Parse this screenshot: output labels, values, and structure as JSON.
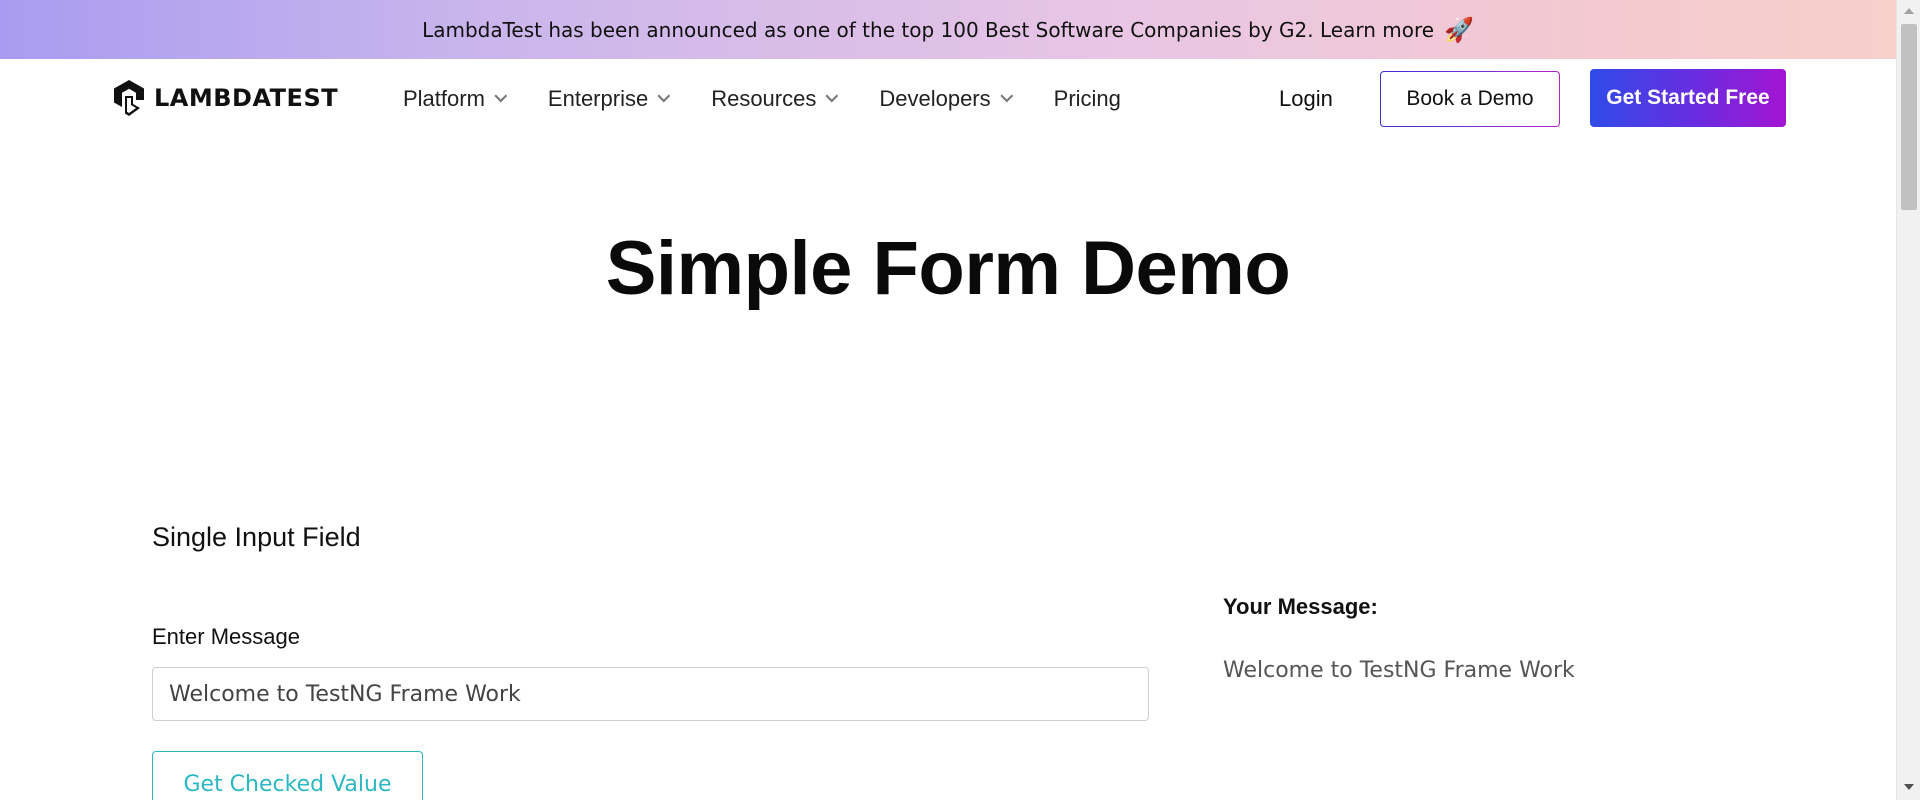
{
  "banner": {
    "text": "LambdaTest has been announced as one of the top 100 Best Software Companies by G2. Learn more",
    "icon": "rocket-icon",
    "gradient": [
      "#a99cf0",
      "#f6d0cb"
    ]
  },
  "navbar": {
    "logo_text": "LAMBDATEST",
    "menu": [
      {
        "label": "Platform",
        "has_dropdown": true
      },
      {
        "label": "Enterprise",
        "has_dropdown": true
      },
      {
        "label": "Resources",
        "has_dropdown": true
      },
      {
        "label": "Developers",
        "has_dropdown": true
      },
      {
        "label": "Pricing",
        "has_dropdown": false
      }
    ],
    "login_label": "Login",
    "book_demo_label": "Book a Demo",
    "get_started_label": "Get Started Free",
    "accent_gradient": [
      "#2f4be8",
      "#a414d2"
    ]
  },
  "hero": {
    "title": "Simple Form Demo"
  },
  "form": {
    "section_title": "Single Input Field",
    "field_label": "Enter Message",
    "input_value": "Welcome to TestNG Frame Work",
    "button_label": "Get Checked Value",
    "button_color": "#2bb8c2"
  },
  "output": {
    "label": "Your Message:",
    "value": "Welcome to TestNG Frame Work"
  }
}
